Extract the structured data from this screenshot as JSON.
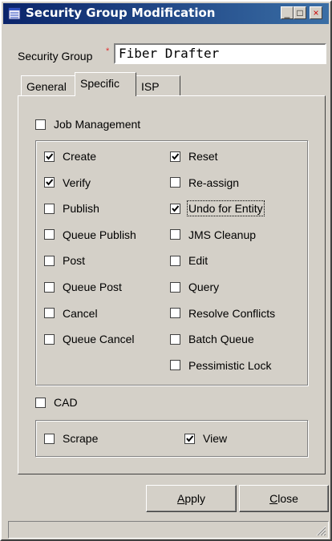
{
  "window": {
    "title": "Security Group Modification",
    "minimize": "_",
    "restore": "□",
    "close": "×"
  },
  "security_group": {
    "label": "Security Group",
    "required_marker": "*",
    "value": "Fiber Drafter"
  },
  "tabs": [
    {
      "label": "General",
      "active": false
    },
    {
      "label": "Specific",
      "active": true
    },
    {
      "label": "ISP",
      "active": false
    }
  ],
  "job_management": {
    "label": "Job Management",
    "checked": false,
    "left": [
      {
        "label": "Create",
        "checked": true
      },
      {
        "label": "Verify",
        "checked": true
      },
      {
        "label": "Publish",
        "checked": false
      },
      {
        "label": "Queue Publish",
        "checked": false
      },
      {
        "label": "Post",
        "checked": false
      },
      {
        "label": "Queue Post",
        "checked": false
      },
      {
        "label": "Cancel",
        "checked": false
      },
      {
        "label": "Queue Cancel",
        "checked": false
      }
    ],
    "right": [
      {
        "label": "Reset",
        "checked": true
      },
      {
        "label": "Re-assign",
        "checked": false
      },
      {
        "label": "Undo for Entity",
        "checked": true
      },
      {
        "label": "JMS Cleanup",
        "checked": false
      },
      {
        "label": "Edit",
        "checked": false
      },
      {
        "label": "Query",
        "checked": false
      },
      {
        "label": "Resolve Conflicts",
        "checked": false
      },
      {
        "label": "Batch Queue",
        "checked": false
      },
      {
        "label": "Pessimistic Lock",
        "checked": false
      }
    ]
  },
  "cad": {
    "label": "CAD",
    "checked": false,
    "scrape": {
      "label": "Scrape",
      "checked": false
    },
    "view": {
      "label": "View",
      "checked": true
    }
  },
  "buttons": {
    "apply": {
      "mnemonic": "A",
      "rest": "pply"
    },
    "close": {
      "mnemonic": "C",
      "rest": "lose"
    }
  },
  "colors": {
    "title_gradient_start": "#0a246a",
    "title_gradient_end": "#3a6ea5",
    "face": "#d4d0c8",
    "required": "#e03030"
  }
}
